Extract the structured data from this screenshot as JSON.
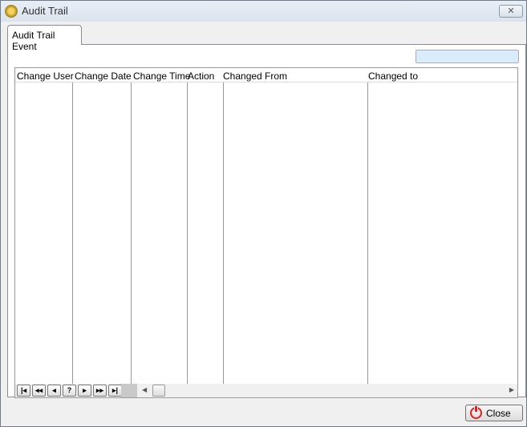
{
  "window": {
    "title": "Audit Trail",
    "close_icon": "close-icon"
  },
  "tabs": [
    {
      "label": "Audit Trail Event",
      "active": true
    }
  ],
  "search": {
    "value": "",
    "placeholder": ""
  },
  "grid": {
    "columns": [
      "Change User",
      "Change Date",
      "Change Time",
      "Action",
      "Changed From",
      "Changed to"
    ],
    "rows": []
  },
  "navigator": {
    "buttons": [
      "first",
      "prior-page",
      "prior",
      "refresh",
      "next",
      "next-page",
      "last"
    ],
    "help_label": "?"
  },
  "footer": {
    "close_label": "Close"
  }
}
